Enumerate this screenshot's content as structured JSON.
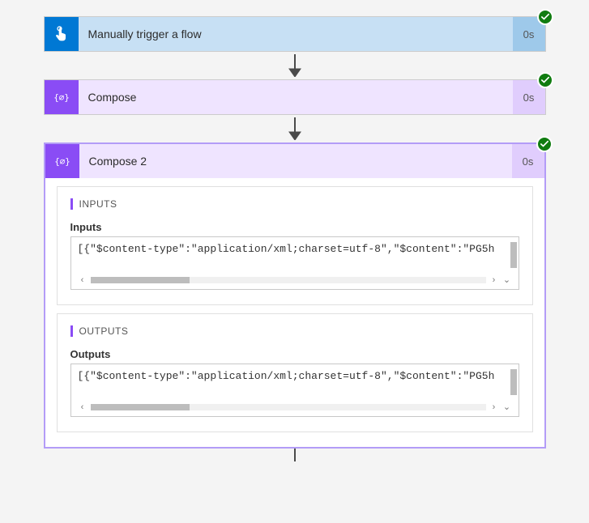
{
  "trigger": {
    "title": "Manually trigger a flow",
    "duration": "0s",
    "status": "success"
  },
  "compose1": {
    "title": "Compose",
    "duration": "0s",
    "status": "success"
  },
  "compose2": {
    "title": "Compose 2",
    "duration": "0s",
    "status": "success",
    "inputs_section_label": "INPUTS",
    "inputs_field_label": "Inputs",
    "inputs_value": "[{\"$content-type\":\"application/xml;charset=utf-8\",\"$content\":\"PG5h",
    "outputs_section_label": "OUTPUTS",
    "outputs_field_label": "Outputs",
    "outputs_value": "[{\"$content-type\":\"application/xml;charset=utf-8\",\"$content\":\"PG5h"
  }
}
